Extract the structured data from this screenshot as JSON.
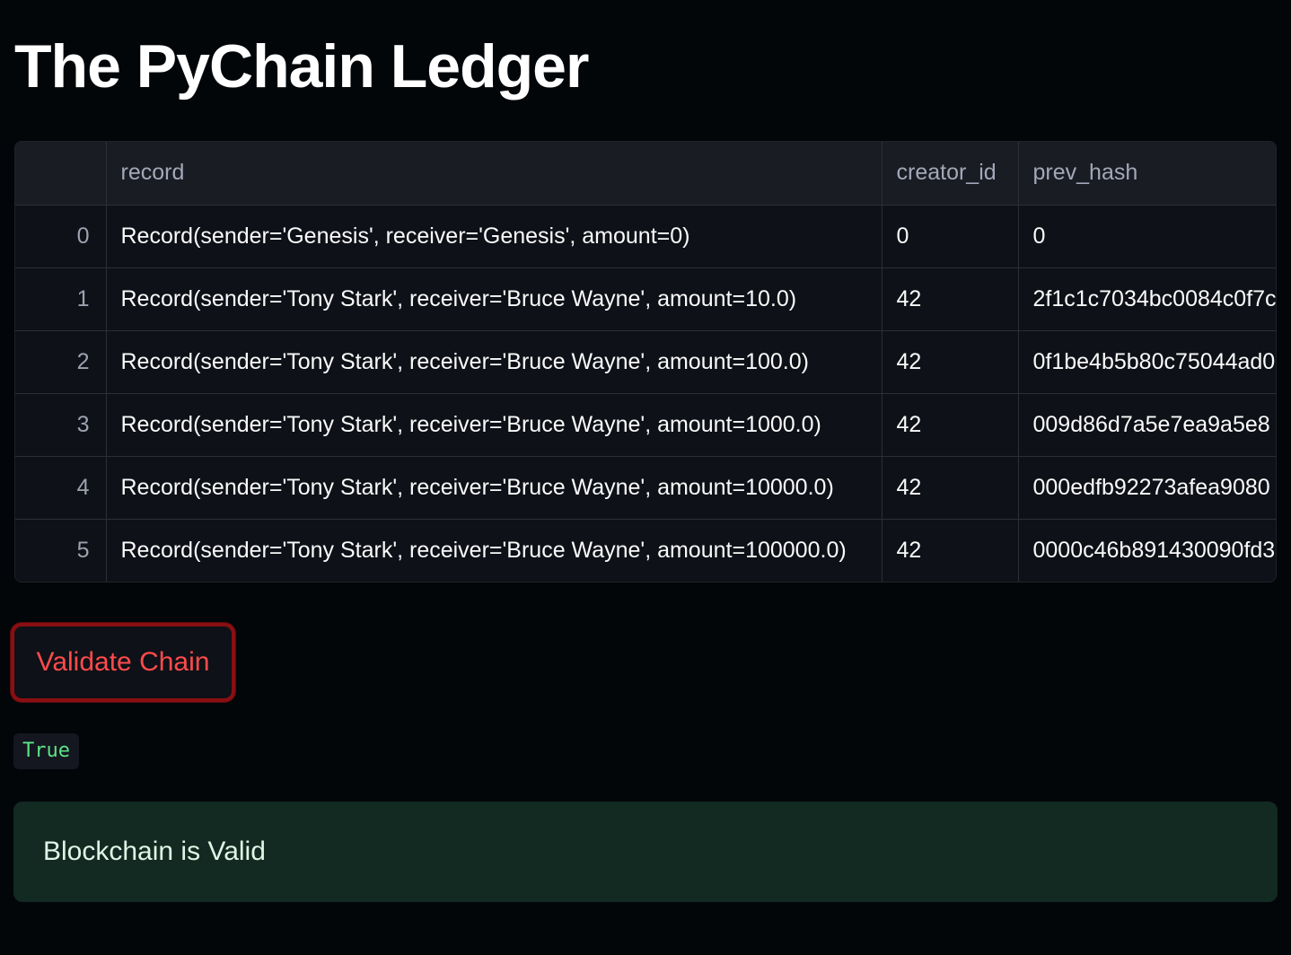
{
  "page": {
    "title": "The PyChain Ledger"
  },
  "table": {
    "columns": [
      "",
      "record",
      "creator_id",
      "prev_hash"
    ],
    "rows": [
      {
        "index": "0",
        "record": "Record(sender='Genesis', receiver='Genesis', amount=0)",
        "creator_id": "0",
        "prev_hash": "0"
      },
      {
        "index": "1",
        "record": "Record(sender='Tony Stark', receiver='Bruce Wayne', amount=10.0)",
        "creator_id": "42",
        "prev_hash": "2f1c1c7034bc0084c0f7c"
      },
      {
        "index": "2",
        "record": "Record(sender='Tony Stark', receiver='Bruce Wayne', amount=100.0)",
        "creator_id": "42",
        "prev_hash": "0f1be4b5b80c75044ad0"
      },
      {
        "index": "3",
        "record": "Record(sender='Tony Stark', receiver='Bruce Wayne', amount=1000.0)",
        "creator_id": "42",
        "prev_hash": "009d86d7a5e7ea9a5e8"
      },
      {
        "index": "4",
        "record": "Record(sender='Tony Stark', receiver='Bruce Wayne', amount=10000.0)",
        "creator_id": "42",
        "prev_hash": "000edfb92273afea9080"
      },
      {
        "index": "5",
        "record": "Record(sender='Tony Stark', receiver='Bruce Wayne', amount=100000.0)",
        "creator_id": "42",
        "prev_hash": "0000c46b891430090fd3"
      }
    ]
  },
  "actions": {
    "validate_label": "Validate Chain"
  },
  "result": {
    "code_value": "True",
    "success_message": "Blockchain is Valid"
  },
  "colors": {
    "background": "#030609",
    "button_text": "#ff4b4b",
    "button_border": "#8a0f12",
    "code_text": "#5ce488",
    "success_bg": "#122a21"
  }
}
